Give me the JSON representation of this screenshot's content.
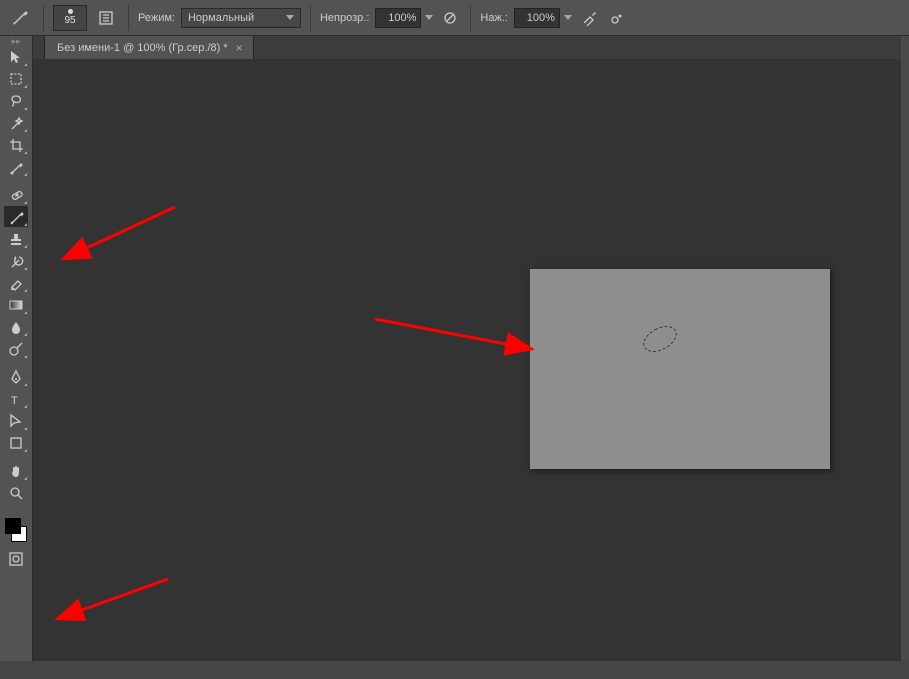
{
  "options": {
    "brush_size": "95",
    "mode_label": "Режим:",
    "mode_value": "Нормальный",
    "opacity_label": "Непрозр.:",
    "opacity_value": "100%",
    "flow_label": "Наж.:",
    "flow_value": "100%"
  },
  "tab": {
    "title": "Без имени-1 @ 100% (Гр.сер./8) *",
    "close": "×"
  },
  "tools": [
    {
      "name": "move-tool"
    },
    {
      "name": "marquee-tool"
    },
    {
      "name": "lasso-tool"
    },
    {
      "name": "wand-tool"
    },
    {
      "name": "crop-tool"
    },
    {
      "name": "eyedropper-tool"
    },
    {
      "name": "heal-tool"
    },
    {
      "name": "brush-tool",
      "active": true
    },
    {
      "name": "stamp-tool"
    },
    {
      "name": "history-brush-tool"
    },
    {
      "name": "eraser-tool"
    },
    {
      "name": "gradient-tool"
    },
    {
      "name": "blur-tool"
    },
    {
      "name": "dodge-tool"
    },
    {
      "name": "pen-tool"
    },
    {
      "name": "type-tool"
    },
    {
      "name": "path-select-tool"
    },
    {
      "name": "shape-tool"
    },
    {
      "name": "hand-tool"
    },
    {
      "name": "zoom-tool"
    }
  ]
}
